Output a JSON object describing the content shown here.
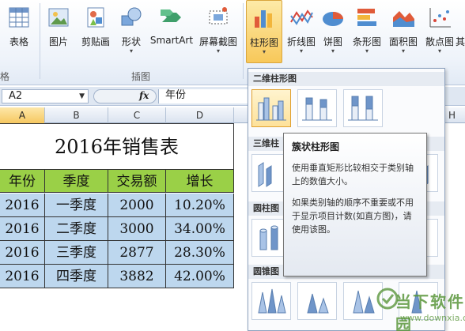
{
  "ribbon": {
    "buttons": [
      {
        "label": "表格",
        "icon": "table-icon",
        "dropdown": ""
      },
      {
        "label": "图片",
        "icon": "picture-icon",
        "dropdown": ""
      },
      {
        "label": "剪贴画",
        "icon": "clipart-icon",
        "dropdown": ""
      },
      {
        "label": "形状",
        "icon": "shapes-icon",
        "dropdown": "▾"
      },
      {
        "label": "SmartArt",
        "icon": "smartart-icon",
        "dropdown": ""
      },
      {
        "label": "屏幕截图",
        "icon": "screenshot-icon",
        "dropdown": "▾"
      },
      {
        "label": "柱形图",
        "icon": "bar-chart-icon",
        "dropdown": "▾"
      },
      {
        "label": "折线图",
        "icon": "line-chart-icon",
        "dropdown": "▾"
      },
      {
        "label": "饼图",
        "icon": "pie-chart-icon",
        "dropdown": "▾"
      },
      {
        "label": "条形图",
        "icon": "horizontal-bar-chart-icon",
        "dropdown": "▾"
      },
      {
        "label": "面积图",
        "icon": "area-chart-icon",
        "dropdown": "▾"
      },
      {
        "label": "散点图",
        "icon": "scatter-chart-icon",
        "dropdown": "▾"
      },
      {
        "label": "其",
        "icon": "other-chart-icon",
        "dropdown": ""
      }
    ],
    "groups": {
      "left_partial": "格",
      "illustrations": "插图"
    }
  },
  "formula_bar": {
    "name_box": "A2",
    "fx": "fx",
    "formula": "年份"
  },
  "columns": [
    "A",
    "B",
    "C",
    "D",
    "H"
  ],
  "sheet": {
    "title": "2016年销售表",
    "headers": [
      "年份",
      "季度",
      "交易额",
      "增长"
    ],
    "rows": [
      [
        "2016",
        "一季度",
        "2000",
        "10.20%"
      ],
      [
        "2016",
        "二季度",
        "3000",
        "34.00%"
      ],
      [
        "2016",
        "三季度",
        "2877",
        "28.30%"
      ],
      [
        "2016",
        "四季度",
        "3882",
        "42.00%"
      ]
    ]
  },
  "dropdown": {
    "sections": [
      "二维柱形图",
      "三维柱",
      "圆柱图",
      "圆锥图"
    ]
  },
  "tooltip": {
    "title": "簇状柱形图",
    "body1": "使用垂直矩形比较相交于类别轴上的数值大小。",
    "body2": "如果类别轴的顺序不重要或不用于显示项目计数(如直方图)，请使用该图。"
  },
  "watermark": {
    "text": "当下软件园",
    "sub": "www.downxia.com"
  },
  "colors": {
    "header_fill": "#9ad047",
    "body_fill": "#bdd7ee",
    "selected_accent": "#f8c85a"
  }
}
